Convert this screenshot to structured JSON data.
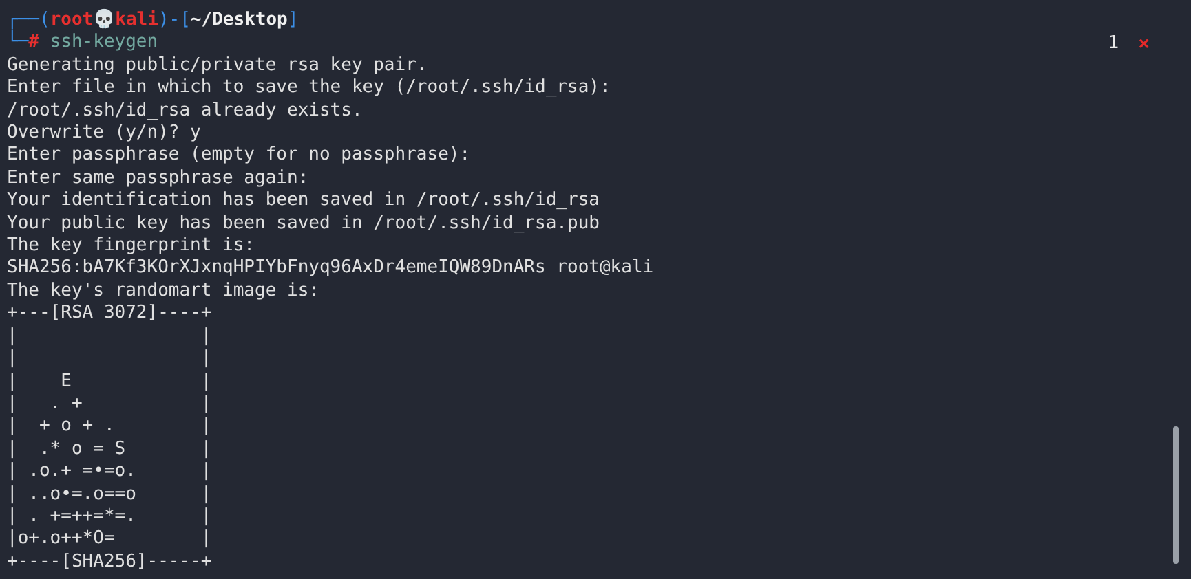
{
  "prompt": {
    "line1": [
      {
        "kind": "frame",
        "text": "┌──("
      },
      {
        "kind": "user",
        "text": "root💀kali"
      },
      {
        "kind": "frame",
        "text": ")-["
      },
      {
        "kind": "path",
        "text": "~/Desktop"
      },
      {
        "kind": "frame",
        "text": "]"
      }
    ],
    "line2": [
      {
        "kind": "frame",
        "text": "└─"
      },
      {
        "kind": "symbol",
        "text": "#"
      },
      {
        "kind": "command",
        "text": " ssh-keygen"
      }
    ]
  },
  "tab_indicator": {
    "count": "1",
    "close": "×"
  },
  "output": [
    "Generating public/private rsa key pair.",
    "Enter file in which to save the key (/root/.ssh/id_rsa):",
    "/root/.ssh/id_rsa already exists.",
    "Overwrite (y/n)? y",
    "Enter passphrase (empty for no passphrase):",
    "Enter same passphrase again:",
    "Your identification has been saved in /root/.ssh/id_rsa",
    "Your public key has been saved in /root/.ssh/id_rsa.pub",
    "The key fingerprint is:",
    "SHA256:bA7Kf3KOrXJxnqHPIYbFnyq96AxDr4emeIQW89DnARs root@kali",
    "The key's randomart image is:",
    "+---[RSA 3072]----+",
    "|                 |",
    "|                 |",
    "|    E            |",
    "|   . +           |",
    "|  + o + .        |",
    "|  .* o = S       |",
    "| .o.+ =•=o.      |",
    "| ..o•=.o==o      |",
    "| . +=++=*=.      |",
    "|o+.o++*O=        |",
    "+----[SHA256]-----+"
  ]
}
